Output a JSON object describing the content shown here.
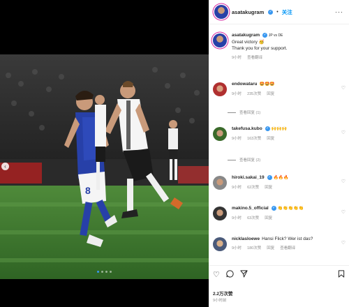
{
  "post": {
    "author": "asatakugram",
    "follow_label": "关注",
    "more_label": "···",
    "caption_user": "asatakugram",
    "caption_tag": "JP vs DE",
    "caption_line1": "Great victory 🥳",
    "caption_line2": "Thank you for your support.",
    "caption_time": "9小时",
    "caption_translate": "查看翻译"
  },
  "comments": [
    {
      "user": "endowataru",
      "text": "🤩🤩🤩",
      "time": "9小时",
      "likes": "235次赞",
      "reply": "回复",
      "replies": "查看回复 (1)"
    },
    {
      "user": "takefusa.kubo",
      "text": "🙌🙌🙌",
      "time": "9小时",
      "likes": "163次赞",
      "reply": "回复",
      "replies": "查看回复 (2)"
    },
    {
      "user": "hiroki.sakai_19",
      "text": "🔥🔥🔥",
      "time": "9小时",
      "likes": "62次赞",
      "reply": "回复",
      "replies": ""
    },
    {
      "user": "makino.5_official",
      "text": "👏👏👏👏👏",
      "time": "9小时",
      "likes": "63次赞",
      "reply": "回复",
      "replies": ""
    },
    {
      "user": "nicklasloewe",
      "text": "Hansi Flick? Wer ist das?",
      "time": "9小时",
      "likes": "180次赞",
      "reply": "回复",
      "translate": "查看翻译",
      "replies": ""
    }
  ],
  "footer": {
    "likes": "2.2万次赞",
    "time": "9小时前"
  },
  "icons": {
    "like": "heart-icon",
    "comment": "comment-icon",
    "share": "share-icon",
    "save": "bookmark-icon"
  }
}
